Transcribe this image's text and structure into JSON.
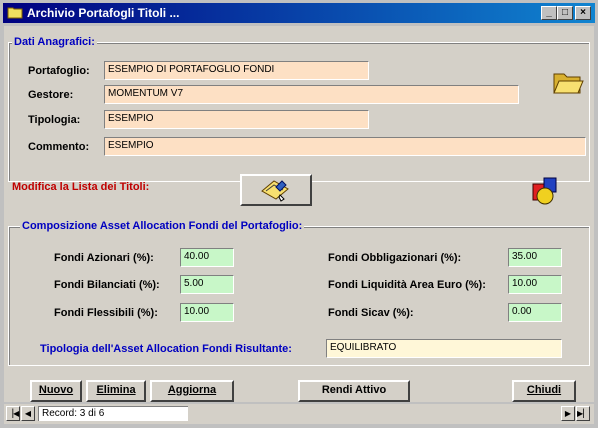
{
  "window": {
    "title": "Archivio Portafogli Titoli ...",
    "controls": [
      "_",
      "□",
      "×"
    ]
  },
  "anagrafici": {
    "section_title": "Dati Anagrafici:",
    "portafoglio_label": "Portafoglio:",
    "portafoglio_value": "ESEMPIO DI PORTAFOGLIO FONDI",
    "gestore_label": "Gestore:",
    "gestore_value": "MOMENTUM V7",
    "tipologia_label": "Tipologia:",
    "tipologia_value": "ESEMPIO",
    "commento_label": "Commento:",
    "commento_value": "ESEMPIO"
  },
  "modifica": {
    "label": "Modifica la Lista dei Titoli:"
  },
  "composizione": {
    "section_title": "Composizione Asset Allocation Fondi del Portafoglio:",
    "azionari_label": "Fondi Azionari (%):",
    "azionari_value": "40.00",
    "bilanciati_label": "Fondi Bilanciati (%):",
    "bilanciati_value": "5.00",
    "flessibili_label": "Fondi Flessibili (%):",
    "flessibili_value": "10.00",
    "obbligazionari_label": "Fondi Obbligazionari (%):",
    "obbligazionari_value": "35.00",
    "liquidita_label": "Fondi Liquidità Area Euro (%):",
    "liquidita_value": "10.00",
    "sicav_label": "Fondi Sicav (%):",
    "sicav_value": "0.00",
    "risultante_label": "Tipologia dell'Asset Allocation Fondi Risultante:",
    "risultante_value": "EQUILIBRATO"
  },
  "buttons": {
    "nuovo": "Nuovo",
    "elimina": "Elimina",
    "aggiorna": "Aggiorna",
    "rendi_attivo": "Rendi Attivo",
    "chiudi": "Chiudi"
  },
  "navigator": {
    "record_text": "Record: 3 di 6"
  },
  "icons": {
    "title": "folder-icon",
    "gestore": "open-folder-icon",
    "modifica": "edit-list-icon",
    "assets": "shapes-icon"
  }
}
